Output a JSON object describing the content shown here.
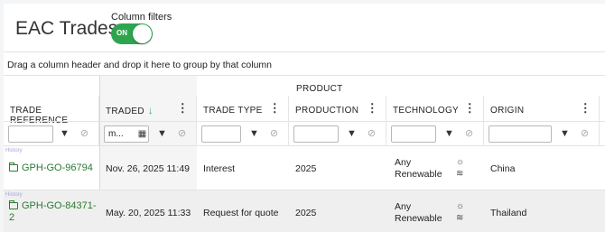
{
  "page": {
    "title": "EAC Trades"
  },
  "filters_toggle": {
    "label": "Column filters",
    "state": "ON"
  },
  "group_bar": {
    "text": "Drag a column header and drop it here to group by that column"
  },
  "header_groups": {
    "product": "PRODUCT"
  },
  "columns": {
    "trade_reference": "TRADE REFERENCE",
    "traded": "TRADED",
    "trade_type": "TRADE TYPE",
    "production": "PRODUCTION",
    "technology": "TECHNOLOGY",
    "origin": "ORIGIN"
  },
  "sort": {
    "column": "TRADED",
    "direction": "descending",
    "arrow": "↓"
  },
  "filter_values": {
    "traded": "m..."
  },
  "menu_glyph": "⋮",
  "rows": [
    {
      "history": "History",
      "trade_reference": "GPH-GO-96794",
      "traded": "Nov. 26, 2025 11:49",
      "trade_type": "Interest",
      "production": "2025",
      "technology": "Any\nRenewable",
      "technology_line1": "Any",
      "technology_line2": "Renewable",
      "origin": "China"
    },
    {
      "history": "History",
      "trade_reference": "GPH-GO-84371-2",
      "trade_reference_line1": "GPH-GO-84371-",
      "trade_reference_line2": "2",
      "traded": "May. 20, 2025 11:33",
      "trade_type": "Request for quote",
      "production": "2025",
      "technology_line1": "Any",
      "technology_line2": "Renewable",
      "origin": "Thailand"
    }
  ],
  "colors": {
    "accent": "#2ea44f",
    "link": "#2a7a32"
  }
}
